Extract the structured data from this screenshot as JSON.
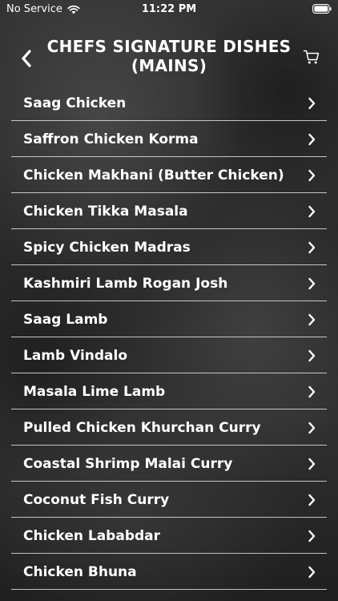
{
  "status_bar": {
    "carrier": "No Service",
    "time": "11:22 PM"
  },
  "header": {
    "title": "CHEFS SIGNATURE DISHES (MAINS)"
  },
  "icons": {
    "back": "back-arrow-icon",
    "cart": "cart-icon",
    "chevron": "chevron-right-icon",
    "wifi": "wifi-icon",
    "battery": "battery-icon"
  },
  "colors": {
    "text": "#ffffff",
    "divider": "#e1e1e1",
    "background": "#2c2c2c"
  },
  "items": [
    {
      "label": "Saag Chicken"
    },
    {
      "label": "Saffron Chicken Korma"
    },
    {
      "label": "Chicken Makhani (Butter Chicken)"
    },
    {
      "label": "Chicken Tikka Masala"
    },
    {
      "label": "Spicy Chicken Madras"
    },
    {
      "label": "Kashmiri Lamb Rogan Josh"
    },
    {
      "label": "Saag Lamb"
    },
    {
      "label": "Lamb Vindalo"
    },
    {
      "label": "Masala Lime Lamb"
    },
    {
      "label": "Pulled Chicken Khurchan Curry"
    },
    {
      "label": "Coastal Shrimp Malai Curry"
    },
    {
      "label": "Coconut Fish Curry"
    },
    {
      "label": "Chicken Lababdar"
    },
    {
      "label": "Chicken Bhuna"
    }
  ]
}
